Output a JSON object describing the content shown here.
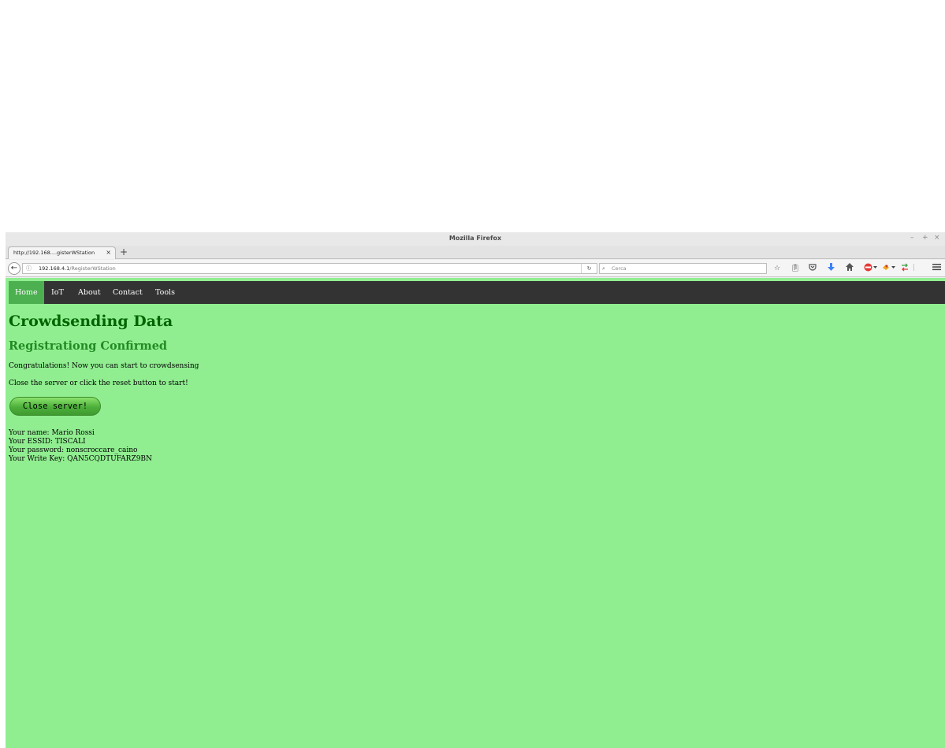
{
  "browser": {
    "window_title": "Mozilla Firefox",
    "window_controls": {
      "minimize": "–",
      "maximize": "+",
      "close": "×"
    },
    "tab": {
      "label": "http://192.168....gisterWStation",
      "close": "×"
    },
    "new_tab": "+",
    "address": {
      "host": "192.168.4.1",
      "path": "/RegisterWStation",
      "info_icon": "ⓘ"
    },
    "search": {
      "placeholder": "Cerca"
    },
    "toolbar_icons": [
      "star-icon",
      "clipboard-icon",
      "pocket-icon",
      "download-icon",
      "home-icon",
      "adblock-icon",
      "extension-icon",
      "sync-icon",
      "menu-icon"
    ]
  },
  "nav": {
    "items": [
      "Home",
      "IoT",
      "About",
      "Contact",
      "Tools"
    ],
    "active": "Home"
  },
  "page": {
    "title": "Crowdsending Data",
    "subtitle": "Registrationg Confirmed",
    "congrats": "Congratulations! Now you can start to crowdsensing",
    "instruction": "Close the server or click the reset button to start!",
    "close_button": "Close server!",
    "info": {
      "name": "Your name: Mario Rossi",
      "essid": "Your ESSID: TISCALI",
      "password": "Your password: nonscroccare_caino",
      "write_key": "Your Write Key: QAN5CQDTUFARZ9BN"
    }
  },
  "colors": {
    "page_background": "#90ee90",
    "menu_background": "#333333",
    "menu_active": "#4caf50",
    "title": "#006400",
    "subtitle": "#228b22"
  }
}
